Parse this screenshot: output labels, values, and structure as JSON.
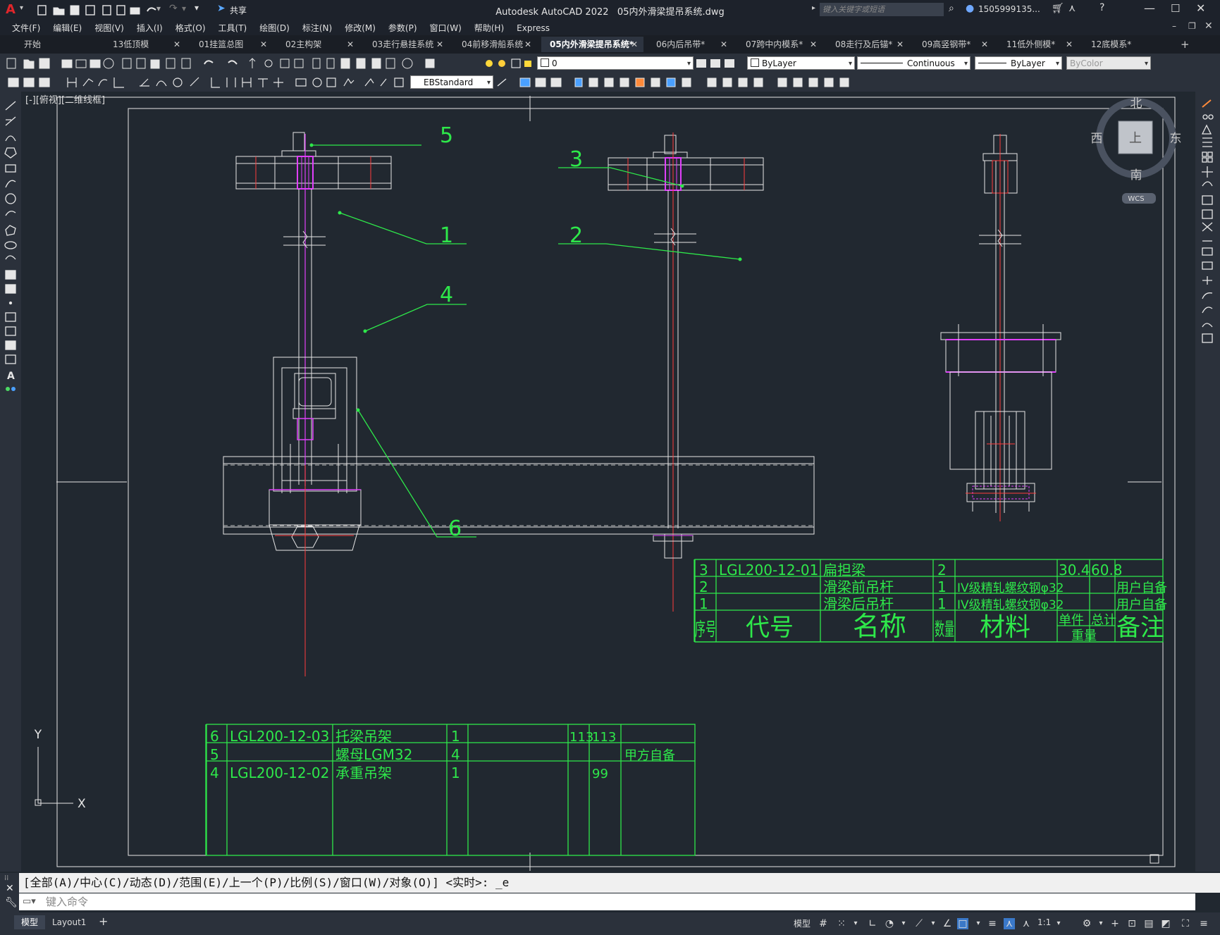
{
  "app": {
    "title": "Autodesk AutoCAD 2022",
    "filename": "05内外滑梁提吊系统.dwg",
    "share": "共享",
    "search_placeholder": "键入关键字或短语",
    "user": "1505999135...",
    "logo": "A"
  },
  "menu": [
    "文件(F)",
    "编辑(E)",
    "视图(V)",
    "插入(I)",
    "格式(O)",
    "工具(T)",
    "绘图(D)",
    "标注(N)",
    "修改(M)",
    "参数(P)",
    "窗口(W)",
    "帮助(H)",
    "Express"
  ],
  "tabs": [
    {
      "label": "开始",
      "close": false
    },
    {
      "label": "13低顶模",
      "close": true
    },
    {
      "label": "01挂篮总图",
      "close": true
    },
    {
      "label": "02主构架",
      "close": true
    },
    {
      "label": "03走行悬挂系统",
      "close": true
    },
    {
      "label": "04前移滑船系统",
      "close": true
    },
    {
      "label": "05内外滑梁提吊系统*",
      "close": true,
      "active": true
    },
    {
      "label": "06内后吊带*",
      "close": true
    },
    {
      "label": "07跨中内模系*",
      "close": true
    },
    {
      "label": "08走行及后锚*",
      "close": true
    },
    {
      "label": "09高竖钢带*",
      "close": true
    },
    {
      "label": "11低外侧模*",
      "close": true
    },
    {
      "label": "12底模系*",
      "close": false
    }
  ],
  "props": {
    "layer": "0",
    "color": "ByLayer",
    "linetype": "Continuous",
    "lineweight": "ByLayer",
    "plotstyle": "ByColor",
    "dimstyle": "EBStandard"
  },
  "viewport": {
    "label": "[-][俯视][二维线框]",
    "compass": {
      "n": "北",
      "s": "南",
      "e": "东",
      "w": "西",
      "top": "上",
      "wcs": "WCS"
    },
    "ucs": {
      "x": "X",
      "y": "Y"
    }
  },
  "drawing": {
    "callouts": [
      "5",
      "3",
      "1",
      "2",
      "4",
      "6"
    ],
    "bom_right": {
      "rows": [
        {
          "no": "3",
          "code": "LGL200-12-01",
          "name": "扁担梁",
          "qty": "2",
          "material": "",
          "unit": "30.4",
          "total": "60.8",
          "note": ""
        },
        {
          "no": "2",
          "code": "",
          "name": "滑梁前吊杆",
          "qty": "1",
          "material": "IV级精轧螺纹钢φ32",
          "unit": "",
          "total": "",
          "note": "用户自备"
        },
        {
          "no": "1",
          "code": "",
          "name": "滑梁后吊杆",
          "qty": "1",
          "material": "IV级精轧螺纹钢φ32",
          "unit": "",
          "total": "",
          "note": "用户自备"
        }
      ],
      "header": {
        "no": "序号",
        "code": "代号",
        "name": "名称",
        "qty": "数量",
        "material": "材料",
        "unit": "单件",
        "total": "总计",
        "weight": "重量",
        "note": "备注"
      }
    },
    "bom_left": {
      "rows": [
        {
          "no": "6",
          "code": "LGL200-12-03",
          "name": "托梁吊架",
          "qty": "1",
          "material": "",
          "unit": "113",
          "total": "113",
          "note": ""
        },
        {
          "no": "5",
          "code": "",
          "name": "螺母LGM32",
          "qty": "4",
          "material": "",
          "unit": "",
          "total": "",
          "note": "甲方自备"
        },
        {
          "no": "4",
          "code": "LGL200-12-02",
          "name": "承重吊架",
          "qty": "1",
          "material": "",
          "unit": "",
          "total": "99",
          "note": ""
        }
      ]
    }
  },
  "command": {
    "history": "[全部(A)/中心(C)/动态(D)/范围(E)/上一个(P)/比例(S)/窗口(W)/对象(O)] <实时>: _e",
    "placeholder": "键入命令"
  },
  "status": {
    "model_tab": "模型",
    "layout_tab": "Layout1",
    "model_label": "模型",
    "scale": "1:1"
  }
}
